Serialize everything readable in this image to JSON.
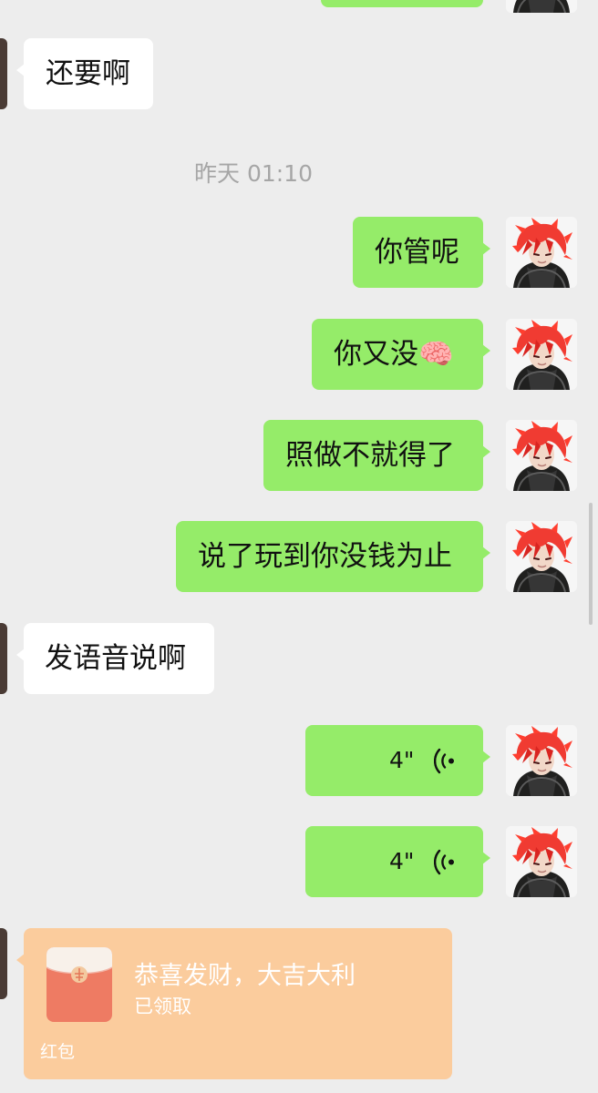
{
  "chat": {
    "timestamp": "昨天 01:10",
    "messages": [
      {
        "sender": "other",
        "type": "text",
        "text": "还要啊"
      },
      {
        "sender": "self",
        "type": "text",
        "text": "你管呢"
      },
      {
        "sender": "self",
        "type": "text",
        "text": "你又没🧠"
      },
      {
        "sender": "self",
        "type": "text",
        "text": "照做不就得了"
      },
      {
        "sender": "self",
        "type": "text",
        "text": "说了玩到你没钱为止"
      },
      {
        "sender": "other",
        "type": "text",
        "text": "发语音说啊"
      },
      {
        "sender": "self",
        "type": "voice",
        "duration": "4\""
      },
      {
        "sender": "self",
        "type": "voice",
        "duration": "4\""
      },
      {
        "sender": "other",
        "type": "red-envelope",
        "title": "恭喜发财，大吉大利",
        "status": "已领取",
        "footer": "红包"
      }
    ]
  },
  "icons": {
    "self_avatar": "red-haired-character-avatar",
    "voice": "voice-wave-icon",
    "red_envelope": "red-envelope-icon"
  },
  "colors": {
    "background": "#ededed",
    "outgoing_bubble": "#95ec69",
    "incoming_bubble": "#ffffff",
    "red_envelope_card": "#fbcc9d",
    "timestamp": "#a6a6a6"
  }
}
